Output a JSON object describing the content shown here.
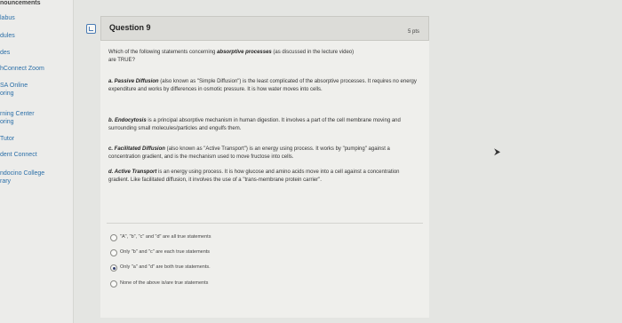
{
  "sidebar": {
    "items": [
      {
        "label": "nouncements"
      },
      {
        "label": "labus"
      },
      {
        "label": "dules"
      },
      {
        "label": "des"
      },
      {
        "label": "hConnect Zoom"
      },
      {
        "label": "SA Online"
      },
      {
        "label": "oring"
      },
      {
        "label": "rning Center"
      },
      {
        "label": "oring"
      },
      {
        "label": "Tutor"
      },
      {
        "label": "dent Connect"
      },
      {
        "label": "ndocino College"
      },
      {
        "label": "rary"
      }
    ]
  },
  "question": {
    "title": "Question 9",
    "points": "5 pts",
    "prompt_a": "Which of the following statements concerning ",
    "prompt_em": "absorptive processes",
    "prompt_b": " (as discussed in the lecture video)",
    "prompt_c": "are TRUE?",
    "statements": [
      {
        "lead": "a. Passive Diffusion",
        "text": " (also known as \"Simple Diffusion\") is the least complicated of the absorptive processes. It requires no energy expenditure and works by differences in osmotic pressure. It is how water moves into cells."
      },
      {
        "lead": "b. Endocytosis",
        "text": " is a principal absorptive mechanism in human digestion. It involves a part of the cell membrane moving and surrounding small molecules/particles and engulfs them."
      },
      {
        "lead": "c. Facilitated Diffusion",
        "text": " (also known as \"Active Transport\") is an energy using process. It works by \"pumping\" against a concentration gradient, and is the mechanism used to move fructose into cells."
      },
      {
        "lead": "d. Active Transport",
        "text": " is an energy using process. It is how glucose and amino acids move into a cell against a concentration gradient. Like facilitated diffusion, it involves the use of a \"trans-membrane protein carrier\"."
      }
    ],
    "answers": [
      {
        "label": "\"A\", \"b\", \"c\" and \"d\" are all true statements",
        "selected": false
      },
      {
        "label": "Only \"b\" and \"c\" are each true statements",
        "selected": false
      },
      {
        "label": "Only \"a\" and \"d\" are both true statements.",
        "selected": true
      },
      {
        "label": "None of the above is/are true statements",
        "selected": false
      }
    ]
  }
}
